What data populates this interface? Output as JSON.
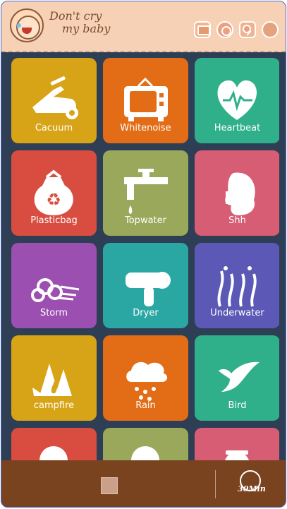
{
  "app": {
    "title_line1": "Don't cry",
    "title_line2": "my baby",
    "accent": "#f7d1b5",
    "bg": "#2e3e55",
    "footer_bg": "#7a4320"
  },
  "header_icons": [
    "tv-icon",
    "gear-icon",
    "rattle-icon",
    "hands-icon"
  ],
  "tiles": [
    {
      "label": "Cacuum",
      "color": "#d8a417",
      "icon": "vacuum-icon"
    },
    {
      "label": "Whitenoise",
      "color": "#e36d17",
      "icon": "tv-icon"
    },
    {
      "label": "Heartbeat",
      "color": "#2fb08a",
      "icon": "heart-icon"
    },
    {
      "label": "Plasticbag",
      "color": "#d94d41",
      "icon": "bag-icon"
    },
    {
      "label": "Topwater",
      "color": "#9aa85b",
      "icon": "faucet-icon"
    },
    {
      "label": "Shh",
      "color": "#d65d73",
      "icon": "woman-icon"
    },
    {
      "label": "Storm",
      "color": "#9b4fb0",
      "icon": "wind-icon"
    },
    {
      "label": "Dryer",
      "color": "#2aa7a2",
      "icon": "dryer-icon"
    },
    {
      "label": "Underwater",
      "color": "#5b58b6",
      "icon": "seaweed-icon"
    },
    {
      "label": "campfire",
      "color": "#d8a417",
      "icon": "campfire-icon"
    },
    {
      "label": "Rain",
      "color": "#e36d17",
      "icon": "rain-icon"
    },
    {
      "label": "Bird",
      "color": "#2fb08a",
      "icon": "bird-icon"
    },
    {
      "label": "",
      "color": "#d94d41",
      "icon": "partial-icon"
    },
    {
      "label": "",
      "color": "#9aa85b",
      "icon": "partial-icon"
    },
    {
      "label": "",
      "color": "#d65d73",
      "icon": "teapot-icon"
    }
  ],
  "footer": {
    "stop_label": "Stop",
    "timer_text": "30",
    "timer_unit": "Min"
  }
}
